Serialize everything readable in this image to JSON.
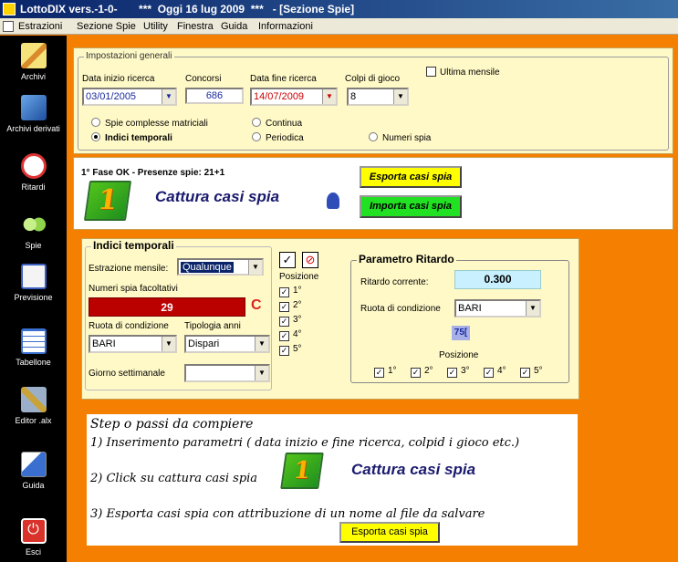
{
  "window": {
    "title": "LottoDIX vers.-1-0-       ***  Oggi 16 lug 2009  ***   - [Sezione Spie]"
  },
  "menu": [
    "Estrazioni",
    "Sezione Spie",
    "Utility",
    "Finestra",
    "Guida",
    "Informazioni"
  ],
  "sidebar": [
    {
      "label": "Archivi",
      "icon": "pencil-icon"
    },
    {
      "label": "Archivi derivati",
      "icon": "books-icon"
    },
    {
      "label": "Ritardi",
      "icon": "clock-icon"
    },
    {
      "label": "Spie",
      "icon": "binoculars-icon"
    },
    {
      "label": "Previsione",
      "icon": "calculator-icon"
    },
    {
      "label": "Tabellone",
      "icon": "table-icon"
    },
    {
      "label": "Editor .alx",
      "icon": "tools-icon"
    },
    {
      "label": "Guida",
      "icon": "book-icon"
    },
    {
      "label": "Esci",
      "icon": "exit-icon"
    }
  ],
  "impostazioni": {
    "title": "Impostazioni generali",
    "data_inizio_label": "Data inizio ricerca",
    "data_inizio_value": "03/01/2005",
    "concorsi_label": "Concorsi",
    "concorsi_value": "686",
    "data_fine_label": "Data fine ricerca",
    "data_fine_value": "14/07/2009",
    "colpi_label": "Colpi di gioco",
    "colpi_value": "8",
    "ultima_mensile": "Ultima mensile",
    "radio_spie_complesse": "Spie complesse matriciali",
    "radio_indici": "Indici temporali",
    "radio_continua": "Continua",
    "radio_periodica": "Periodica",
    "radio_numeri_spia": "Numeri spia"
  },
  "fase": {
    "status": "1° Fase OK - Presenze spie: 21+1",
    "icon_digit": "1",
    "cattura_label": "Cattura casi spia",
    "esporta_button": "Esporta casi spia",
    "importa_button": "Importa casi spia"
  },
  "indici": {
    "title": "Indici temporali",
    "estrazione_label": "Estrazione mensile:",
    "estrazione_value": "Qualunque",
    "posizione_label": "Posizione",
    "positions": [
      "1°",
      "2°",
      "3°",
      "4°",
      "5°"
    ],
    "numeri_label": "Numeri spia facoltativi",
    "numeri_value": "29",
    "c_label": "C",
    "ruota_label": "Ruota di condizione",
    "ruota_value": "BARI",
    "tipologia_label": "Tipologia anni",
    "tipologia_value": "Dispari",
    "giorno_label": "Giorno settimanale",
    "giorno_value": ""
  },
  "ritardo": {
    "title": "Parametro Ritardo",
    "corrente_label": "Ritardo corrente:",
    "corrente_value": "0.300",
    "ruota_label": "Ruota di condizione",
    "ruota_value": "BARI",
    "badge": "75[",
    "posizione_label": "Posizione",
    "positions": [
      "1°",
      "2°",
      "3°",
      "4°",
      "5°"
    ]
  },
  "steps": {
    "title": "Step o passi da compiere",
    "step1": "1) Inserimento parametri ( data inizio e fine ricerca, colpid i gioco etc.)",
    "step2": "2) Click su cattura casi spia",
    "step2_icon_digit": "1",
    "step2_cattura": "Cattura casi spia",
    "step3": "3) Esporta casi spia con attribuzione di un nome al file da salvare",
    "esporta_button": "Esporta casi spia"
  }
}
